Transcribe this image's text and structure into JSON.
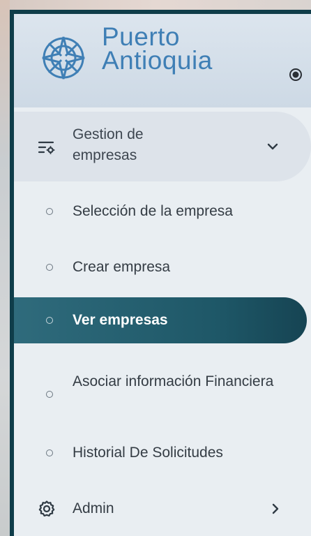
{
  "brand": {
    "line1": "Puerto",
    "line2": "Antioquia",
    "logo_icon": "compass-rose-icon",
    "collapse_icon": "radio-toggle-icon"
  },
  "menu": {
    "group": {
      "label": "Gestion de empresas",
      "icon": "list-settings-icon",
      "chevron": "chevron-down-icon",
      "items": [
        {
          "label": "Selección de la empresa",
          "active": false
        },
        {
          "label": "Crear empresa",
          "active": false
        },
        {
          "label": "Ver empresas",
          "active": true
        },
        {
          "label": "Asociar información Financiera",
          "active": false
        },
        {
          "label": "Historial De Solicitudes",
          "active": false
        }
      ]
    },
    "admin": {
      "label": "Admin",
      "icon": "gear-icon",
      "chevron": "chevron-right-icon"
    }
  },
  "colors": {
    "brand": "#3f7fb5",
    "active_bg": "#1e5767",
    "border": "#0f3d4a"
  }
}
